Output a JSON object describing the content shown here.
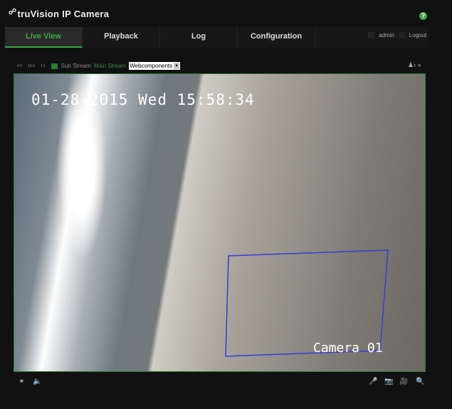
{
  "header": {
    "logo": "truVision",
    "title": "IP Camera",
    "help": "?"
  },
  "nav": {
    "tabs": [
      "Live View",
      "Playback",
      "Log",
      "Configuration"
    ],
    "active": "Live View",
    "user": "admin",
    "logout": "Logout"
  },
  "toolbar": {
    "ratios": [
      "4:3",
      "16:9",
      "1:1"
    ],
    "sub_stream": "Sub Stream",
    "main_stream": "Main Stream",
    "plugin_select": "Webcomponents"
  },
  "video": {
    "timestamp": "01-28-2015 Wed 15:58:34",
    "camera_name": "Camera 01",
    "motion_box_color": "#3a3ad8"
  },
  "colors": {
    "accent": "#3fa83f"
  }
}
